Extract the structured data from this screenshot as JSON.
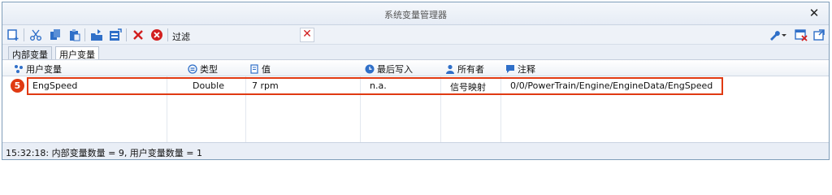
{
  "window": {
    "title": "系统变量管理器",
    "close_glyph": "✕"
  },
  "toolbar": {
    "filter_label": "过滤",
    "filter_value": "",
    "icons": [
      "new-variable-icon",
      "cut-icon",
      "copy-icon",
      "paste-icon",
      "import-icon",
      "export-icon",
      "delete-icon",
      "delete-all-icon",
      "wrench-icon",
      "clear-filter-icon",
      "window-icon"
    ]
  },
  "tabs": [
    {
      "label": "内部变量",
      "active": false
    },
    {
      "label": "用户变量",
      "active": true
    }
  ],
  "table": {
    "columns": [
      "用户变量",
      "类型",
      "值",
      "最后写入",
      "所有者",
      "注释"
    ],
    "rows": [
      {
        "name": "EngSpeed",
        "type": "Double",
        "value": "7 rpm",
        "last_written": "n.a.",
        "owner": "信号映射",
        "comment": "0/0/PowerTrain/Engine/EngineData/EngSpeed"
      }
    ]
  },
  "annotation": {
    "badge": "5"
  },
  "status": {
    "text": "15:32:18: 内部变量数量 = 9, 用户变量数量 = 1"
  },
  "colors": {
    "highlight": "#e03a12",
    "accent_blue": "#2f6fc8",
    "delete_red": "#d21f1f"
  }
}
